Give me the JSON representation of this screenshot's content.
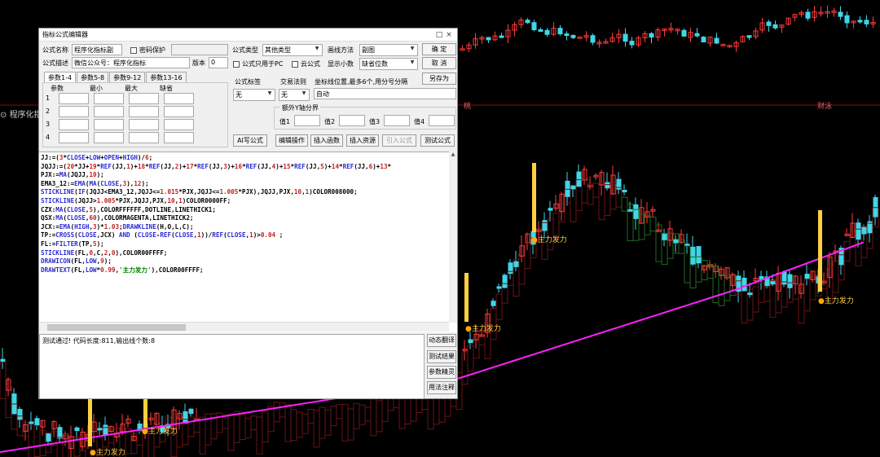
{
  "chart": {
    "indicator_name": "程序化指标",
    "axis_tags": [
      "桃",
      "财泳"
    ],
    "signal_text": "主力发力",
    "colors": {
      "up": "#ff3b3b",
      "down": "#3fd6e8",
      "ma": "#ff20ff",
      "signal": "#ffd040"
    }
  },
  "dialog": {
    "title": "指标公式编辑器",
    "win_buttons": [
      "□",
      "×"
    ],
    "name_label": "公式名称",
    "name_value": "程序化指标副",
    "password_label": "密码保护",
    "desc_label": "公式描述",
    "desc_value": "微信公众号：程序化指标",
    "version_label": "版本",
    "version_value": "0",
    "type_label": "公式类型",
    "type_value": "其他类型",
    "draw_label": "画线方法",
    "draw_value": "副图",
    "ok_label": "确 定",
    "cancel_label": "取 消",
    "pc_only_label": "公式只用于PC",
    "cloud_label": "云公式",
    "decimal_label": "显示小数",
    "decimal_value": "缺省位数",
    "saveas_label": "另存为",
    "tabs": [
      "参数1-4",
      "参数5-8",
      "参数9-12",
      "参数13-16"
    ],
    "param_headers": [
      "参数",
      "最小",
      "最大",
      "缺省"
    ],
    "param_rows": [
      "1",
      "2",
      "3",
      "4"
    ],
    "formula_label_title": "公式标签",
    "formula_label_value": "无",
    "trade_rule_title": "交易法则",
    "trade_rule_value": "无",
    "coord_title": "坐标线位置,最多6个,用分号分隔",
    "coord_value": "自动",
    "yaxis_title": "额外Y轴分界",
    "y_values": [
      "值1",
      "值2",
      "值3",
      "值4"
    ],
    "buttons": [
      "AI写公式",
      "编辑操作",
      "插入函数",
      "插入资源",
      "引入公式",
      "测试公式"
    ],
    "code_lines": [
      "JJ:=(3*CLOSE+LOW+OPEN+HIGH)/6;",
      "JQJJ:=(20*JJ+19*REF(JJ,1)+18*REF(JJ,2)+17*REF(JJ,3)+16*REF(JJ,4)+15*REF(JJ,5)+14*REF(JJ,6)+13*",
      "PJX:=MA(JQJJ,10);",
      "EMA3_12:=EMA(MA(CLOSE,3),12);",
      "STICKLINE(IF(JQJJ<EMA3_12,JQJJ<=1.015*PJX,JQJJ<=1.005*PJX),JQJJ,PJX,10,1)COLOR008000;",
      "STICKLINE(JQJJ>1.005*PJX,JQJJ,PJX,10,1)COLOR0000FF;",
      "CZX:MA(CLOSE,5),COLORFFFFFF,DOTLINE,LINETHICK1;",
      "QSX:MA(CLOSE,60),COLORMAGENTA,LINETHICK2;",
      "JCX:=EMA(HIGH,3)*1.03;DRAWKLINE(H,O,L,C);",
      "TP:=CROSS(CLOSE,JCX) AND (CLOSE-REF(CLOSE,1))/REF(CLOSE,1)>0.04 ;",
      "FL:=FILTER(TP,5);",
      "STICKLINE(FL,0,C,2,0),COLOR00FFFF;",
      "DRAWICON(FL,LOW,9);",
      "DRAWTEXT(FL,LOW*0.99,'主力发力'),COLOR00FFFF;"
    ],
    "status_text": "测试通过! 代码长度:811,输出线个数:8",
    "side_buttons": [
      "动态翻译",
      "测试结果",
      "参数精灵",
      "用法注释"
    ]
  }
}
